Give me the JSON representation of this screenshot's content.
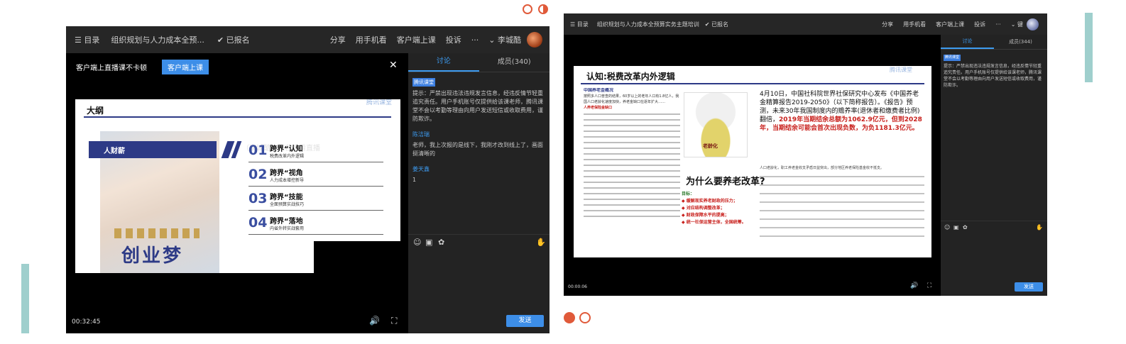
{
  "left": {
    "header": {
      "menu_label": "☰ 目录",
      "course_title": "组织规划与人力成本全预...",
      "enrolled": "✔ 已报名",
      "share": "分享",
      "mobile": "用手机看",
      "client": "客户端上课",
      "complaint": "投诉",
      "more": "···",
      "user": "⌄ 李城酷"
    },
    "banner": {
      "text": "客户端上直播课不卡顿",
      "button": "客户端上课",
      "close": "✕"
    },
    "slide": {
      "title": "大纲",
      "left_label": "人财薪",
      "bottom_text": "创业梦",
      "watermark": "腾讯课堂",
      "ghost_text": "（李城酷）正在观看直播",
      "items": [
        {
          "num": "01",
          "title": "跨界“认知",
          "sub": "税费改革内外逻辑"
        },
        {
          "num": "02",
          "title": "跨界“视角",
          "sub": "人力成本增控新导"
        },
        {
          "num": "03",
          "title": "跨界“技能",
          "sub": "全面预算实战技巧"
        },
        {
          "num": "04",
          "title": "跨界“落地",
          "sub": "内省外转实战套用"
        }
      ]
    },
    "player": {
      "time": "00:32:45"
    },
    "sidebar": {
      "tab_discuss": "讨论",
      "tab_members": "成员(340)",
      "notice_tag": "腾讯课堂",
      "notice": "提示：严禁出现违法违规发言信息，经违反情节轻重追究责任。用户手机账号仅提供给该课老师，腾讯课堂不会以考勤等理由向用户发送短信或收取费用，谨防欺诈。",
      "messages": [
        {
          "name": "陈洁瑞",
          "text": "老师，我上次报的是线下，我刚才改到线上了，画面挺清晰的"
        },
        {
          "name": "姜天鑫",
          "text": "1"
        }
      ],
      "send": "发送"
    }
  },
  "right": {
    "header": {
      "menu_label": "☰ 目录",
      "course_title": "组织规划与人力成本全预算实务主题培训",
      "enrolled": "✔ 已报名",
      "share": "分享",
      "mobile": "用手机看",
      "client": "客户端上课",
      "complaint": "投诉",
      "more": "···",
      "user": "⌄ 键"
    },
    "slide": {
      "title": "认知:税费改革内外逻辑",
      "left_heading": "中国养老金概况",
      "left_text": "按照多人口普查的结果，60岁以上的老年人口有1.8亿人，我国人口老龄化速度加快，养老金缺口在逐年扩大……",
      "red_text": "人养老保险金缺口",
      "cartoon_label": "老龄化",
      "why_title": "为什么要养老改革?",
      "reasons_heading": "目标：",
      "reasons": [
        "◆ 缓解现实养老财政的压力；",
        "◆ 对应结构调整改革；",
        "◆ 财政保障水平的提高；",
        "◆ 统一社保运营主体，全国统筹。"
      ],
      "main_text": "4月10日，中国社科院世界社保研究中心发布《中国养老金精算报告2019-2050》（以下简称报告）。《报告》预测，未来30年我国制度内的赡养率(退休者和缴费者比例)翻倍，",
      "main_red": "2019年当期结余总额为1062.9亿元，但到2028年，当期结余可能会首次出现负数，为负1181.3亿元。",
      "small_text": "人口老龄化，职工养老金收支矛盾日益突出，部分地区养老保险基金收不抵支。",
      "watermark": "腾讯课堂"
    },
    "player": {
      "time": "00:00:06"
    },
    "sidebar": {
      "tab_discuss": "讨论",
      "tab_members": "成员(344)",
      "notice_tag": "腾讯课堂",
      "notice": "提示：严禁出现违法违规发言信息，经违反情节轻重追究责任。用户手机账号仅提供给该课老师，腾讯课堂不会以考勤等理由向用户发送短信或收取费用，谨防欺诈。",
      "send": "发送"
    }
  },
  "colors": {
    "accent_blue": "#3d9bf0",
    "deco_teal": "#9fcfcd",
    "deco_red": "#e05a3a",
    "slide_navy": "#2d3a86"
  },
  "icons": [
    "emoji-icon",
    "image-icon",
    "flower-icon",
    "hand-icon",
    "volume-icon",
    "fullscreen-icon",
    "close-icon",
    "menu-icon"
  ]
}
